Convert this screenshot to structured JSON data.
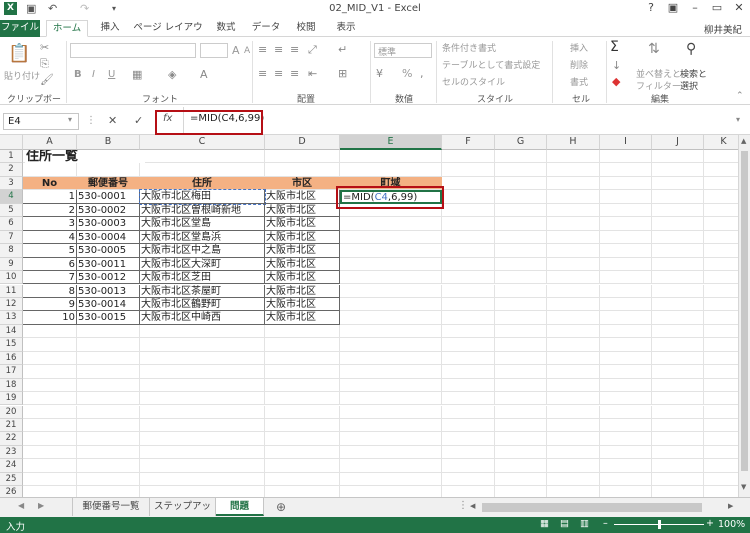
{
  "window": {
    "title": "02_MID_V1 - Excel",
    "user": "柳井美紀",
    "minimize": "–",
    "restore": "▭",
    "close": "✕",
    "help": "?",
    "ribbon_display": "▣"
  },
  "tabs": [
    "ファイル",
    "ホーム",
    "挿入",
    "ページ レイアウト",
    "数式",
    "データ",
    "校閲",
    "表示"
  ],
  "ribbon": {
    "clipboard": {
      "label": "クリップボード",
      "paste": "貼り付け"
    },
    "font": {
      "label": "フォント",
      "bold": "B",
      "italic": "I",
      "underline": "U",
      "grow": "A",
      "shrink": "A"
    },
    "alignment": {
      "label": "配置"
    },
    "number": {
      "label": "数値",
      "format": "標準",
      "percent": "%"
    },
    "styles": {
      "label": "スタイル",
      "conditional": "条件付き書式",
      "table": "テーブルとして書式設定",
      "cell": "セルのスタイル"
    },
    "cells": {
      "label": "セル",
      "insert": "挿入",
      "delete": "削除",
      "format": "書式"
    },
    "editing": {
      "label": "編集",
      "sort": "並べ替えと",
      "filter": "フィルター",
      "find": "検索と",
      "select": "選択"
    }
  },
  "formula_bar": {
    "name_box": "E4",
    "fx": "fx",
    "formula": "=MID(C4,6,99)"
  },
  "columns": [
    "A",
    "B",
    "C",
    "D",
    "E",
    "F",
    "G",
    "H",
    "I",
    "J",
    "K"
  ],
  "rows": [
    "1",
    "2",
    "3",
    "4",
    "5",
    "6",
    "7",
    "8",
    "9",
    "10",
    "11",
    "12",
    "13",
    "14",
    "15",
    "16",
    "17",
    "18",
    "19",
    "20",
    "21",
    "22",
    "23",
    "24",
    "25",
    "26"
  ],
  "sheet": {
    "title": "住所一覧",
    "headers": [
      "No",
      "郵便番号",
      "住所",
      "市区",
      "町域"
    ],
    "data": [
      [
        "1",
        "530-0001",
        "大阪市北区梅田",
        "大阪市北区"
      ],
      [
        "2",
        "530-0002",
        "大阪市北区曽根崎新地",
        "大阪市北区"
      ],
      [
        "3",
        "530-0003",
        "大阪市北区堂島",
        "大阪市北区"
      ],
      [
        "4",
        "530-0004",
        "大阪市北区堂島浜",
        "大阪市北区"
      ],
      [
        "5",
        "530-0005",
        "大阪市北区中之島",
        "大阪市北区"
      ],
      [
        "6",
        "530-0011",
        "大阪市北区大深町",
        "大阪市北区"
      ],
      [
        "7",
        "530-0012",
        "大阪市北区芝田",
        "大阪市北区"
      ],
      [
        "8",
        "530-0013",
        "大阪市北区茶屋町",
        "大阪市北区"
      ],
      [
        "9",
        "530-0014",
        "大阪市北区鶴野町",
        "大阪市北区"
      ],
      [
        "10",
        "530-0015",
        "大阪市北区中崎西",
        "大阪市北区"
      ]
    ],
    "edit_prefix": "=MID(",
    "edit_ref": "C4",
    "edit_suffix": ",6,99)"
  },
  "sheet_tabs": [
    "郵便番号一覧",
    "ステップアップ",
    "問題"
  ],
  "status": {
    "mode": "入力",
    "zoom": "100%"
  },
  "colors": {
    "excel_green": "#217346",
    "header_fill": "#f4b183",
    "highlight": "#b50f15",
    "ref_blue": "#4472c4"
  }
}
